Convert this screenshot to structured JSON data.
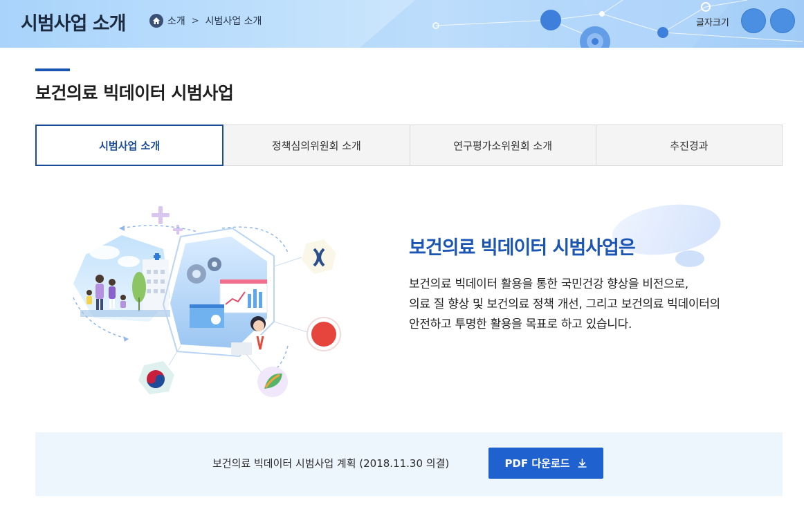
{
  "header": {
    "title": "시범사업 소개",
    "breadcrumb": [
      "소개",
      "시범사업 소개"
    ],
    "font_size_label": "글자크기"
  },
  "section": {
    "title": "보건의료 빅데이터 시범사업"
  },
  "tabs": [
    {
      "label": "시범사업 소개",
      "active": true
    },
    {
      "label": "정책심의위원회 소개",
      "active": false
    },
    {
      "label": "연구평가소위원회 소개",
      "active": false
    },
    {
      "label": "추진경과",
      "active": false
    }
  ],
  "intro": {
    "title": "보건의료 빅데이터 시범사업은",
    "lines": [
      "보건의료 빅데이터 활용을 통한 국민건강 향상을 비전으로,",
      "의료 질 향상 및 보건의료 정책 개선, 그리고 보건의료 빅데이터의",
      "안전하고 투명한 활용을 목표로 하고 있습니다."
    ]
  },
  "download": {
    "plan_text": "보건의료 빅데이터 시범사업 계획 (2018.11.30 의결)",
    "button_label": "PDF 다운로드"
  },
  "colors": {
    "primary": "#1b55b3",
    "button": "#1f62cf",
    "tab_active_border": "#1b4b96",
    "download_bg": "#edf5fd"
  },
  "icons": [
    "home-icon",
    "download-icon",
    "gear-icon",
    "dna-icon",
    "government-emblem-icon",
    "leaf-icon",
    "sos-icon"
  ]
}
